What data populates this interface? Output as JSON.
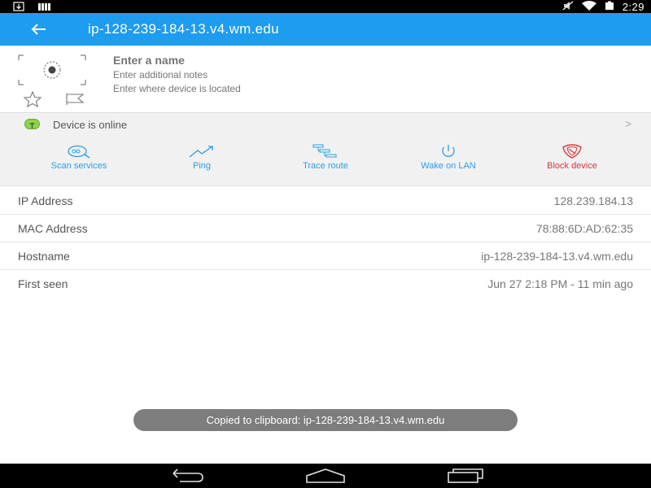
{
  "status_bar": {
    "time": "2:29",
    "icons": [
      "download-icon",
      "signal-bars-icon",
      "mute-icon",
      "wifi-icon",
      "battery-icon"
    ]
  },
  "app_bar": {
    "title": "ip-128-239-184-13.v4.wm.edu"
  },
  "device": {
    "name_placeholder": "Enter a name",
    "notes_placeholder": "Enter additional notes",
    "location_placeholder": "Enter where device is located"
  },
  "status": {
    "online_text": "Device is online",
    "chevron": ">"
  },
  "actions": [
    {
      "label": "Scan services",
      "icon": "scan-services-icon"
    },
    {
      "label": "Ping",
      "icon": "ping-icon"
    },
    {
      "label": "Trace route",
      "icon": "trace-route-icon"
    },
    {
      "label": "Wake on LAN",
      "icon": "power-icon"
    },
    {
      "label": "Block device",
      "icon": "shield-icon"
    }
  ],
  "details": [
    {
      "label": "IP Address",
      "value": "128.239.184.13"
    },
    {
      "label": "MAC Address",
      "value": "78:88:6D:AD:62:35"
    },
    {
      "label": "Hostname",
      "value": "ip-128-239-184-13.v4.wm.edu"
    },
    {
      "label": "First seen",
      "value": "Jun 27 2:18 PM - 11 min ago"
    }
  ],
  "toast": {
    "text": "Copied to clipboard: ip-128-239-184-13.v4.wm.edu"
  },
  "colors": {
    "accent": "#1e9cf0",
    "action_blue": "#2a9ee8",
    "action_red": "#d8383a",
    "online_green": "#8fd14f"
  }
}
